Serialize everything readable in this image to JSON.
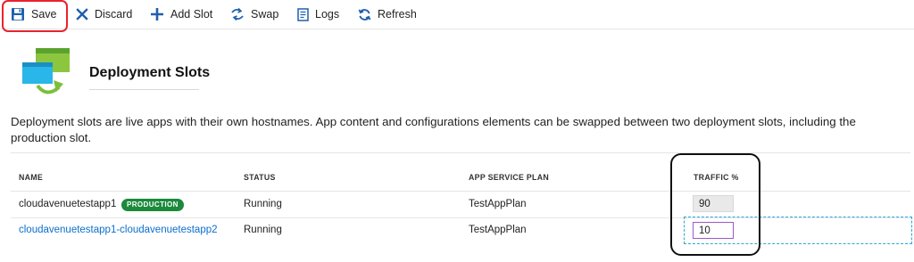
{
  "toolbar": {
    "save": {
      "label": "Save",
      "icon": "save-icon"
    },
    "discard": {
      "label": "Discard",
      "icon": "close-icon"
    },
    "add_slot": {
      "label": "Add Slot",
      "icon": "plus-icon"
    },
    "swap": {
      "label": "Swap",
      "icon": "swap-icon"
    },
    "logs": {
      "label": "Logs",
      "icon": "document-icon"
    },
    "refresh": {
      "label": "Refresh",
      "icon": "refresh-icon"
    }
  },
  "header": {
    "title": "Deployment Slots",
    "icon": "deployment-slots-icon"
  },
  "description": "Deployment slots are live apps with their own hostnames. App content and configurations elements can be swapped between two deployment slots, including the production slot.",
  "table": {
    "columns": [
      "NAME",
      "STATUS",
      "APP SERVICE PLAN",
      "TRAFFIC %"
    ],
    "rows": [
      {
        "name": "cloudavenuetestapp1",
        "badge": "PRODUCTION",
        "status": "Running",
        "plan": "TestAppPlan",
        "traffic": "90"
      },
      {
        "name": "cloudavenuetestapp1-cloudavenuetestapp2",
        "status": "Running",
        "plan": "TestAppPlan",
        "traffic": "10"
      }
    ]
  },
  "colors": {
    "accent": "#0b6fcc",
    "production_badge": "#1b8a3c",
    "highlight_red": "#e8232f",
    "focus_dash": "#2ba9d6"
  }
}
